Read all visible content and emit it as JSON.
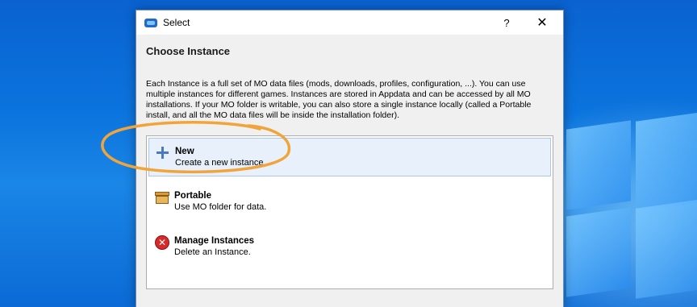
{
  "window": {
    "title": "Select",
    "help_glyph": "?",
    "close_glyph": "✕"
  },
  "dialog": {
    "heading": "Choose Instance",
    "description": "Each Instance is a full set of MO data files (mods, downloads, profiles, configuration, ...). You can use multiple instances for different games. Instances are stored in Appdata and can be accessed by all MO installations. If your MO folder is writable, you can also store a single instance locally (called a Portable install, and all the MO data files will be inside the installation folder).",
    "items": [
      {
        "title": "New",
        "subtitle": "Create a new instance.",
        "icon": "plus-icon",
        "selected": true
      },
      {
        "title": "Portable",
        "subtitle": "Use MO folder for data.",
        "icon": "box-icon",
        "selected": false
      },
      {
        "title": "Manage Instances",
        "subtitle": "Delete an Instance.",
        "icon": "delete-icon",
        "selected": false
      }
    ]
  },
  "colors": {
    "annotation": "#f0a43a",
    "selection_bg": "#e8f1fb",
    "desktop": "#0b73dd"
  }
}
